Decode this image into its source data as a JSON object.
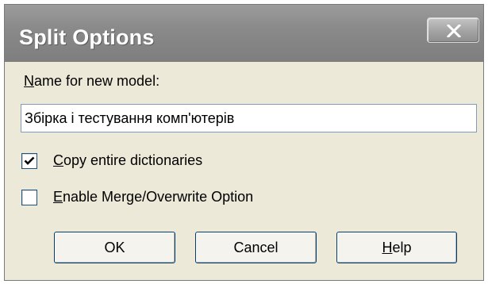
{
  "window": {
    "title": "Split Options",
    "close_glyph": "X"
  },
  "form": {
    "name_label_accel": "N",
    "name_label_rest": "ame for new model:",
    "name_value": "Збірка і тестування комп'ютерів",
    "copy_dictionaries": {
      "checked": true,
      "label_accel": "C",
      "label_rest": "opy entire dictionaries"
    },
    "enable_merge": {
      "checked": false,
      "label_accel": "E",
      "label_rest": "nable Merge/Overwrite Option"
    }
  },
  "buttons": {
    "ok_label": "OK",
    "cancel_label": "Cancel",
    "help_accel": "H",
    "help_rest": "elp"
  },
  "icons": {
    "close": "close-icon",
    "check": "checkmark-icon"
  },
  "colors": {
    "titlebar": "#8a8a8a",
    "dialog_bg": "#ece9d8",
    "button_border": "#003c74"
  }
}
